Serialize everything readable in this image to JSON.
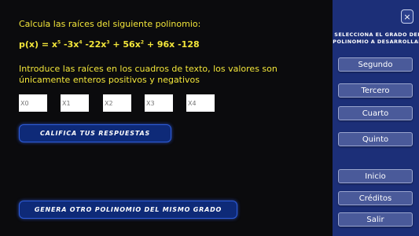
{
  "problem": {
    "prompt": "Calcula las raíces del siguiente polinomio:",
    "poly_lhs": "p(x) = x",
    "terms": [
      {
        "coef": "5",
        "text": " -3x"
      },
      {
        "coef": "4",
        "text": " -22x"
      },
      {
        "coef": "3",
        "text": " + 56x"
      },
      {
        "coef": "2",
        "text": " + 96x -128"
      }
    ],
    "instructions": "Introduce las raíces en los cuadros de texto, los valores son únicamente enteros positivos y negativos"
  },
  "inputs": [
    {
      "placeholder": "X0"
    },
    {
      "placeholder": "X1"
    },
    {
      "placeholder": "X2"
    },
    {
      "placeholder": "X3"
    },
    {
      "placeholder": "X4"
    }
  ],
  "actions": {
    "grade_label": "CALIFICA TUS RESPUESTAS",
    "new_label": "GENERA OTRO POLINOMIO DEL MISMO GRADO"
  },
  "panel": {
    "close_icon": "×",
    "title_line1": "SELECCIONA EL GRADO DEL",
    "title_line2": "POLINOMIO A DESARROLLAR",
    "degrees": [
      "Segundo",
      "Tercero",
      "Cuarto",
      "Quinto"
    ],
    "menu": [
      "Inicio",
      "Créditos",
      "Salir"
    ]
  },
  "colors": {
    "accent_text": "#f3e63a",
    "panel_bg": "#1c2f78",
    "button_bg": "#0e2a78"
  }
}
